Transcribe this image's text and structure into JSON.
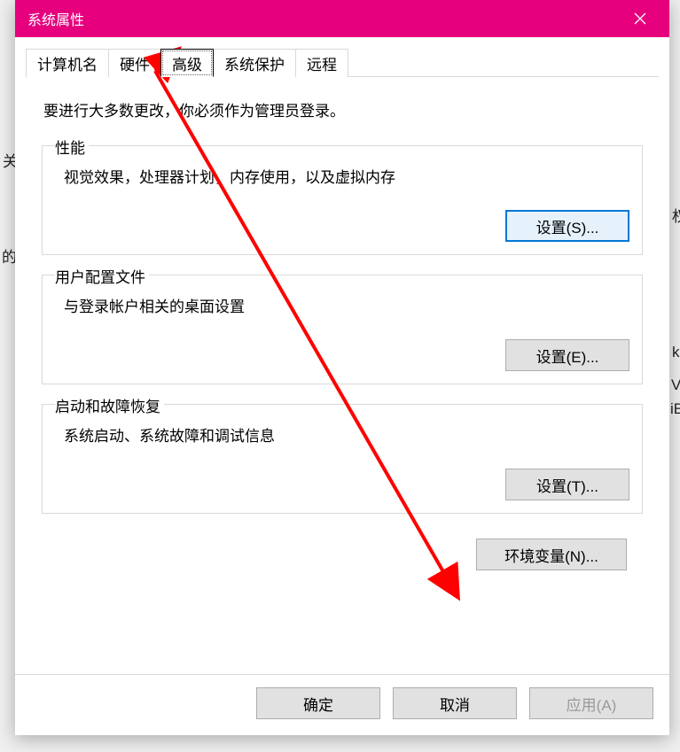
{
  "window": {
    "title": "系统属性"
  },
  "tabs": {
    "computer_name": "计算机名",
    "hardware": "硬件",
    "advanced": "高级",
    "system_protection": "系统保护",
    "remote": "远程"
  },
  "notice": "要进行大多数更改，你必须作为管理员登录。",
  "groups": {
    "performance": {
      "title": "性能",
      "desc": "视觉效果，处理器计划，内存使用，以及虚拟内存",
      "button": "设置(S)..."
    },
    "user_profiles": {
      "title": "用户配置文件",
      "desc": "与登录帐户相关的桌面设置",
      "button": "设置(E)..."
    },
    "startup_recovery": {
      "title": "启动和故障恢复",
      "desc": "系统启动、系统故障和调试信息",
      "button": "设置(T)..."
    }
  },
  "env_button": "环境变量(N)...",
  "bottom": {
    "ok": "确定",
    "cancel": "取消",
    "apply": "应用(A)"
  },
  "bg": {
    "f1": "的",
    "f2": "k",
    "f3": "V",
    "f4": "iE",
    "f5": "权",
    "f6": "关"
  }
}
